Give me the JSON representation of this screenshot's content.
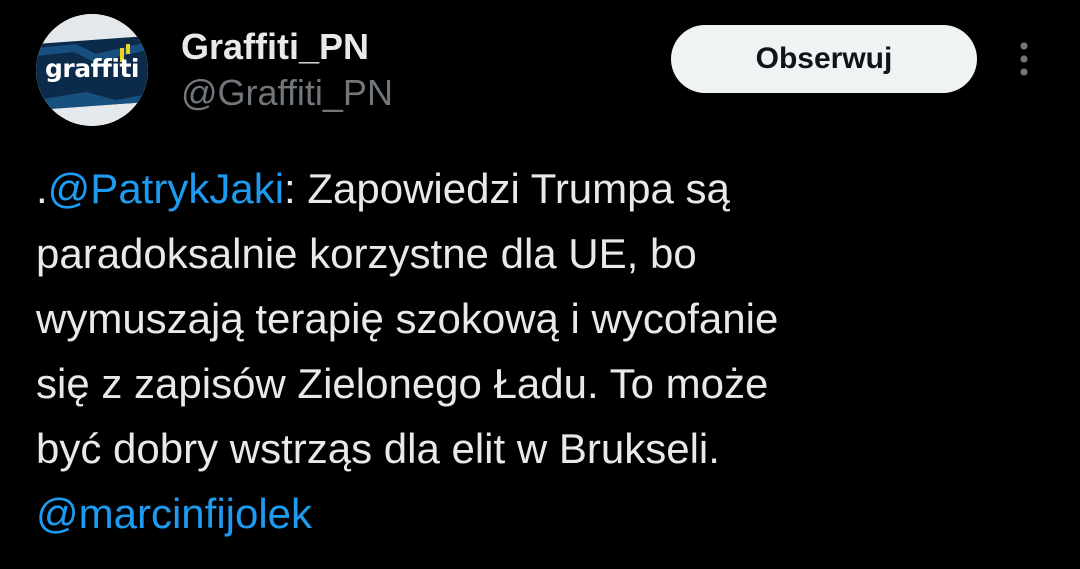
{
  "author": {
    "avatar_text": "graffiti",
    "display_name": "Graffiti_PN",
    "handle": "@Graffiti_PN"
  },
  "follow_button_label": "Obserwuj",
  "icons": {
    "more": "more-vertical-icon"
  },
  "tweet": {
    "prefix": ".",
    "mention_1": "@PatrykJaki",
    "line_1_rest": ": Zapowiedzi Trumpa są",
    "line_2": "paradoksalnie korzystne dla UE, bo",
    "line_3": "wymuszają terapię szokową i wycofanie",
    "line_4": "się z zapisów Zielonego Ładu. To może",
    "line_5": "być dobry wstrząs dla elit w Brukseli.",
    "mention_2": "@marcinfijolek"
  },
  "colors": {
    "background": "#000000",
    "text": "#e7e9ea",
    "secondary_text": "#71767b",
    "link": "#1d9bf0",
    "button_bg": "#eff3f4",
    "button_text": "#0f1419"
  }
}
